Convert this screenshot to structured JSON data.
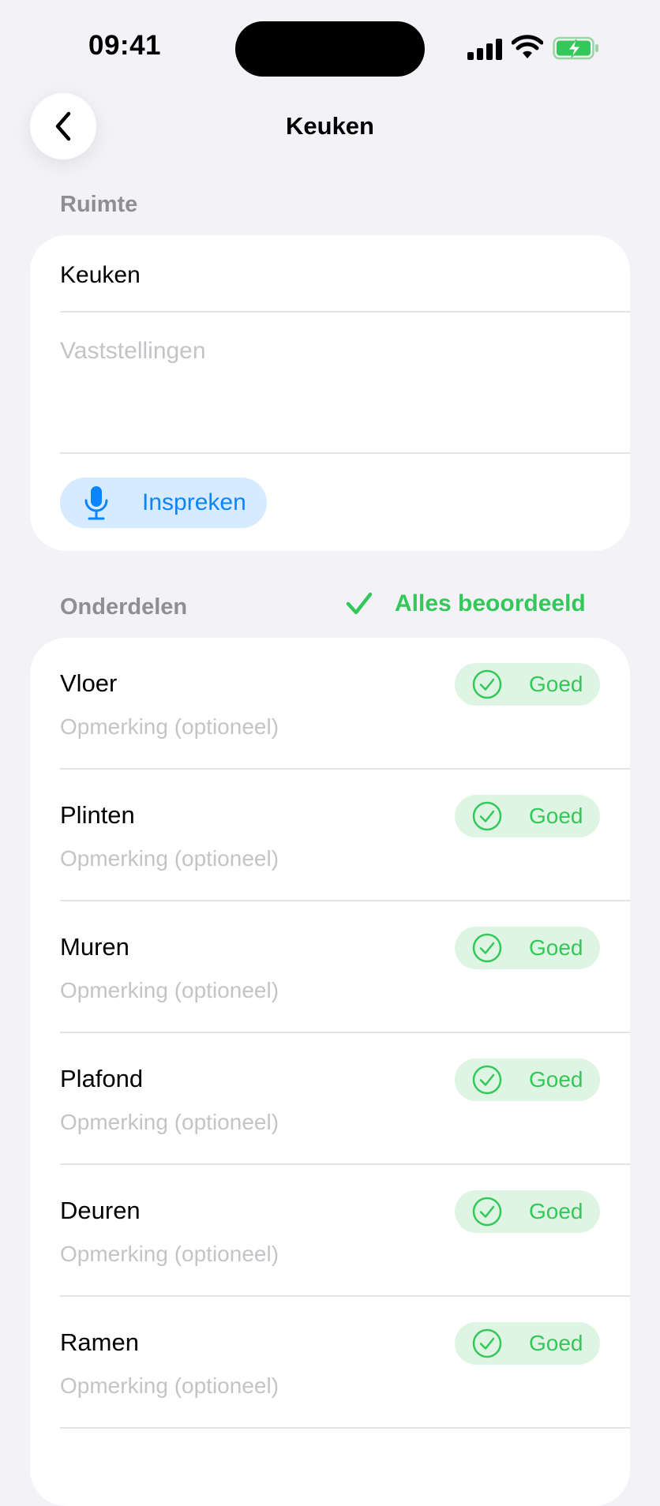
{
  "status_bar": {
    "time": "09:41"
  },
  "nav": {
    "title": "Keuken"
  },
  "room_section": {
    "header": "Ruimte",
    "room_name": "Keuken",
    "observations_placeholder": "Vaststellingen",
    "dictate_label": "Inspreken"
  },
  "parts_section": {
    "header": "Onderdelen",
    "all_reviewed_label": "Alles beoordeeld",
    "items": [
      {
        "name": "Vloer",
        "note_placeholder": "Opmerking (optioneel)",
        "status": "Goed"
      },
      {
        "name": "Plinten",
        "note_placeholder": "Opmerking (optioneel)",
        "status": "Goed"
      },
      {
        "name": "Muren",
        "note_placeholder": "Opmerking (optioneel)",
        "status": "Goed"
      },
      {
        "name": "Plafond",
        "note_placeholder": "Opmerking (optioneel)",
        "status": "Goed"
      },
      {
        "name": "Deuren",
        "note_placeholder": "Opmerking (optioneel)",
        "status": "Goed"
      },
      {
        "name": "Ramen",
        "note_placeholder": "Opmerking (optioneel)",
        "status": "Goed"
      }
    ]
  },
  "colors": {
    "background": "#F2F2F7",
    "accent_blue": "#0A84FF",
    "good_green": "#34C759",
    "good_pill_bg": "#DFF5E4",
    "placeholder": "#C4C4C8"
  }
}
